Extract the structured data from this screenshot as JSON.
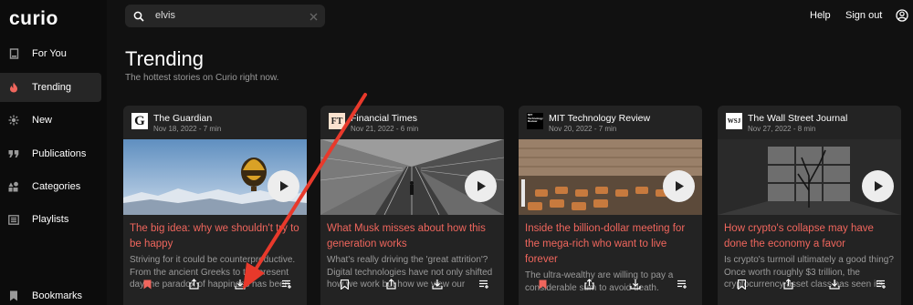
{
  "app": {
    "logo": "curio"
  },
  "sidebar": {
    "items": [
      {
        "label": "For You",
        "icon": "page-icon",
        "active": false
      },
      {
        "label": "Trending",
        "icon": "flame-icon",
        "active": true
      },
      {
        "label": "New",
        "icon": "sparkle-icon",
        "active": false
      },
      {
        "label": "Publications",
        "icon": "quote-icon",
        "active": false
      },
      {
        "label": "Categories",
        "icon": "shapes-icon",
        "active": false
      },
      {
        "label": "Playlists",
        "icon": "list-box-icon",
        "active": false
      },
      {
        "label": "Bookmarks",
        "icon": "bookmark-icon",
        "active": false
      }
    ]
  },
  "search": {
    "value": "elvis"
  },
  "header": {
    "help_label": "Help",
    "signout_label": "Sign out"
  },
  "page": {
    "title": "Trending",
    "subtitle": "The hottest stories on Curio right now."
  },
  "cards": [
    {
      "publication": "The Guardian",
      "logo_text": "G",
      "meta": "Nov 18, 2022 - 7 min",
      "headline": "The big idea: why we shouldn't try to be happy",
      "summary": "Striving for it could be counterproductive. From the ancient Greeks to the present day the paradox of happiness has been",
      "bookmarked": true
    },
    {
      "publication": "Financial Times",
      "logo_text": "FT",
      "meta": "Nov 21, 2022 - 6 min",
      "headline": "What Musk misses about how this generation works",
      "summary": "What's really driving the 'great attrition'? Digital technologies have not only shifted how we work but how we view our",
      "bookmarked": false
    },
    {
      "publication": "MIT Technology Review",
      "logo_text": "MIT Technology Review",
      "meta": "Nov 20, 2022 - 7 min",
      "headline": "Inside the billion-dollar meeting for the mega-rich who want to live forever",
      "summary": "The ultra-wealthy are willing to pay a considerable sum to avoid death.",
      "bookmarked": true
    },
    {
      "publication": "The Wall Street Journal",
      "logo_text": "WSJ",
      "meta": "Nov 27, 2022 - 8 min",
      "headline": "How crypto's collapse may have done the economy a favor",
      "summary": "Is crypto's turmoil ultimately a good thing? Once worth roughly $3 trillion, the cryptocurrency asset class has seen its",
      "bookmarked": false
    }
  ],
  "colors": {
    "accent": "#f0665d",
    "background": "#111111",
    "card": "#232323"
  }
}
